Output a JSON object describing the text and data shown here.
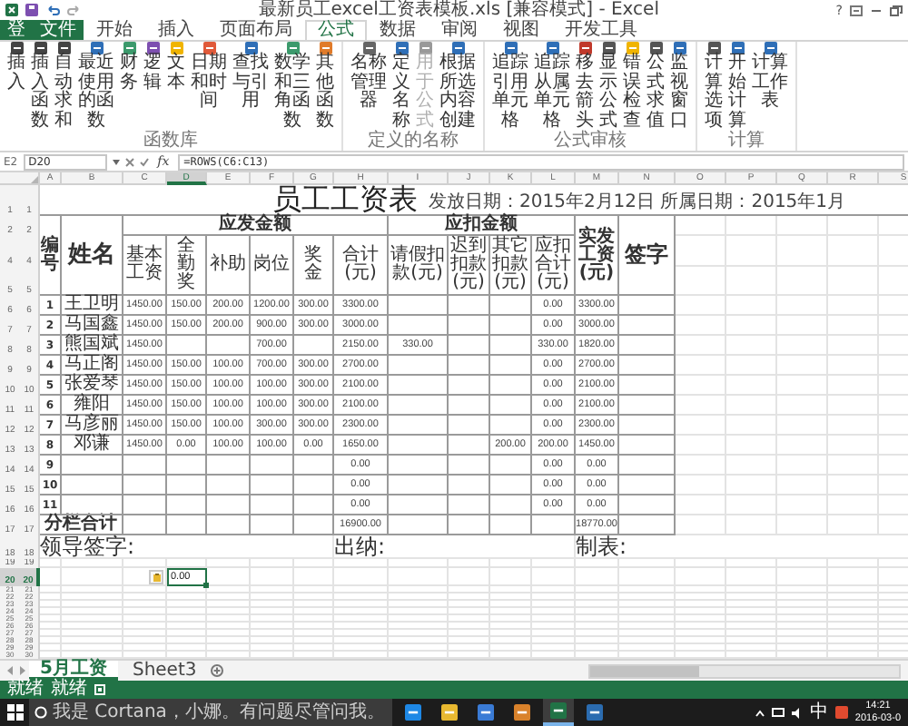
{
  "window": {
    "title": "最新员工excel工资表模板.xls [兼容模式] - Excel",
    "help": "?"
  },
  "ribbon_tabs": [
    {
      "label": "登",
      "kind": "account",
      "selected": false
    },
    {
      "label": "文件",
      "kind": "file",
      "selected": false
    },
    {
      "label": "开始",
      "kind": "tab",
      "selected": false
    },
    {
      "label": "插入",
      "kind": "tab",
      "selected": false
    },
    {
      "label": "页面布局",
      "kind": "tab",
      "selected": false
    },
    {
      "label": "公式",
      "kind": "tab",
      "selected": true
    },
    {
      "label": "数据",
      "kind": "tab",
      "selected": false
    },
    {
      "label": "审阅",
      "kind": "tab",
      "selected": false
    },
    {
      "label": "视图",
      "kind": "tab",
      "selected": false
    },
    {
      "label": "开发工具",
      "kind": "tab",
      "selected": false
    }
  ],
  "ribbon_groups": [
    {
      "label": "函数库",
      "items": [
        {
          "label": "插入",
          "color": "#444444",
          "disabled": false
        },
        {
          "label": "插入函数",
          "color": "#444444",
          "disabled": false
        },
        {
          "label": "自动求和",
          "color": "#444444",
          "disabled": false
        },
        {
          "label": "最近使用的函数",
          "color": "#2f6fb7",
          "disabled": false
        },
        {
          "label": "财务",
          "color": "#3c9a6c",
          "disabled": false
        },
        {
          "label": "逻辑",
          "color": "#7d4fb0",
          "disabled": false
        },
        {
          "label": "文本",
          "color": "#f0b400",
          "disabled": false
        },
        {
          "label": "日期和时间",
          "color": "#e05a3a",
          "disabled": false
        },
        {
          "label": "查找与引用",
          "color": "#2f6fb7",
          "disabled": false
        },
        {
          "label": "数学和三角函数",
          "color": "#3c9a6c",
          "disabled": false
        },
        {
          "label": "其他函数",
          "color": "#e07b2a",
          "disabled": false
        }
      ]
    },
    {
      "label": "定义的名称",
      "items": [
        {
          "label": "名称管理器",
          "color": "#666666",
          "disabled": false
        },
        {
          "label": "定义名称",
          "color": "#2f6fb7",
          "disabled": false
        },
        {
          "label": "用于公式",
          "color": "#999999",
          "disabled": true
        },
        {
          "label": "根据所选内容创建",
          "color": "#2f6fb7",
          "disabled": false
        }
      ]
    },
    {
      "label": "公式审核",
      "items": [
        {
          "label": "追踪引用单元格",
          "color": "#2f6fb7",
          "disabled": false
        },
        {
          "label": "追踪从属单元格",
          "color": "#2f6fb7",
          "disabled": false
        },
        {
          "label": "移去箭头",
          "color": "#c0392b",
          "disabled": false
        },
        {
          "label": "显示公式",
          "color": "#555555",
          "disabled": false
        },
        {
          "label": "错误检查",
          "color": "#f0b400",
          "disabled": false
        },
        {
          "label": "公式求值",
          "color": "#555555",
          "disabled": false
        },
        {
          "label": "监视窗口",
          "color": "#2f6fb7",
          "disabled": false
        }
      ]
    },
    {
      "label": "计算",
      "items": [
        {
          "label": "计算选项",
          "color": "#555555",
          "disabled": false
        },
        {
          "label": "开始计算",
          "color": "#2f6fb7",
          "disabled": false
        },
        {
          "label": "计算工作表",
          "color": "#2f6fb7",
          "disabled": false
        }
      ]
    }
  ],
  "formula_bar": {
    "cell_label": "E2",
    "name_box": "D20",
    "fx": "fx",
    "formula": "=ROWS(C6:C13)"
  },
  "columns": [
    {
      "letter": "A",
      "selected": false
    },
    {
      "letter": "B",
      "selected": false
    },
    {
      "letter": "C",
      "selected": false
    },
    {
      "letter": "D",
      "selected": true
    },
    {
      "letter": "E",
      "selected": false
    },
    {
      "letter": "F",
      "selected": false
    },
    {
      "letter": "G",
      "selected": false
    },
    {
      "letter": "H",
      "selected": false
    },
    {
      "letter": "I",
      "selected": false
    },
    {
      "letter": "J",
      "selected": false
    },
    {
      "letter": "K",
      "selected": false
    },
    {
      "letter": "L",
      "selected": false
    },
    {
      "letter": "M",
      "selected": false
    },
    {
      "letter": "N",
      "selected": false
    },
    {
      "letter": "O",
      "selected": false
    },
    {
      "letter": "P",
      "selected": false
    },
    {
      "letter": "Q",
      "selected": false
    },
    {
      "letter": "R",
      "selected": false
    },
    {
      "letter": "S",
      "selected": false
    }
  ],
  "row_headers": [
    {
      "labels": [
        "1",
        "1"
      ],
      "selected": false
    },
    {
      "labels": [
        "2",
        "2"
      ],
      "selected": false
    },
    {
      "labels": [
        "4",
        "4"
      ],
      "selected": false
    },
    {
      "labels": [
        "5",
        "5"
      ],
      "selected": false
    },
    {
      "labels": [
        "6",
        "6"
      ],
      "selected": false
    },
    {
      "labels": [
        "7",
        "7"
      ],
      "selected": false
    },
    {
      "labels": [
        "8",
        "8"
      ],
      "selected": false
    },
    {
      "labels": [
        "9",
        "9"
      ],
      "selected": false
    },
    {
      "labels": [
        "10",
        "10"
      ],
      "selected": false
    },
    {
      "labels": [
        "11",
        "11"
      ],
      "selected": false
    },
    {
      "labels": [
        "12",
        "12"
      ],
      "selected": false
    },
    {
      "labels": [
        "13",
        "13"
      ],
      "selected": false
    },
    {
      "labels": [
        "14",
        "14"
      ],
      "selected": false
    },
    {
      "labels": [
        "15",
        "15"
      ],
      "selected": false
    },
    {
      "labels": [
        "16",
        "16"
      ],
      "selected": false
    },
    {
      "labels": [
        "17",
        "17"
      ],
      "selected": false
    },
    {
      "labels": [
        "18",
        "18"
      ],
      "selected": false
    },
    {
      "labels": [
        "19",
        "19"
      ],
      "selected": false
    },
    {
      "labels": [
        "20",
        "20"
      ],
      "selected": true
    },
    {
      "labels": [
        "21",
        "21"
      ],
      "selected": false
    },
    {
      "labels": [
        "22",
        "22"
      ],
      "selected": false
    },
    {
      "labels": [
        "23",
        "23"
      ],
      "selected": false
    },
    {
      "labels": [
        "24",
        "24"
      ],
      "selected": false
    },
    {
      "labels": [
        "25",
        "25"
      ],
      "selected": false
    },
    {
      "labels": [
        "26",
        "26"
      ],
      "selected": false
    },
    {
      "labels": [
        "27",
        "27"
      ],
      "selected": false
    },
    {
      "labels": [
        "28",
        "28"
      ],
      "selected": false
    },
    {
      "labels": [
        "29",
        "29"
      ],
      "selected": false
    },
    {
      "labels": [
        "30",
        "30"
      ],
      "selected": false
    }
  ],
  "sheet": {
    "title": "员工工资表",
    "subtitle": "发放日期：2015年2月12日 所属日期：2015年1月",
    "header": {
      "number": "编号",
      "name": "姓名",
      "income_group": "应发金额",
      "deduction_group": "应扣金额",
      "net_pay": "实发工资(元)",
      "signature": "签字",
      "income_columns": [
        "基本工资",
        "全勤奖",
        "补助",
        "岗位",
        "奖金",
        "合计(元)"
      ],
      "deduction_columns": [
        "请假扣款(元)",
        "迟到扣款(元)",
        "其它扣款(元)",
        "应扣合计(元)"
      ]
    },
    "rows": [
      {
        "number": "1",
        "name": "王卫明",
        "values": {
          "C": "1450.00",
          "D": "150.00",
          "E": "200.00",
          "F": "1200.00",
          "G": "300.00",
          "H": "3300.00",
          "L": "0.00",
          "M": "3300.00"
        }
      },
      {
        "number": "2",
        "name": "马国鑫",
        "values": {
          "C": "1450.00",
          "D": "150.00",
          "E": "200.00",
          "F": "900.00",
          "G": "300.00",
          "H": "3000.00",
          "L": "0.00",
          "M": "3000.00"
        }
      },
      {
        "number": "3",
        "name": "熊国斌",
        "values": {
          "C": "1450.00",
          "F": "700.00",
          "H": "2150.00",
          "I": "330.00",
          "L": "330.00",
          "M": "1820.00"
        }
      },
      {
        "number": "4",
        "name": "马正阁",
        "values": {
          "C": "1450.00",
          "D": "150.00",
          "E": "100.00",
          "F": "700.00",
          "G": "300.00",
          "H": "2700.00",
          "L": "0.00",
          "M": "2700.00"
        }
      },
      {
        "number": "5",
        "name": "张爱琴",
        "values": {
          "C": "1450.00",
          "D": "150.00",
          "E": "100.00",
          "F": "100.00",
          "G": "300.00",
          "H": "2100.00",
          "L": "0.00",
          "M": "2100.00"
        }
      },
      {
        "number": "6",
        "name": "雍阳",
        "values": {
          "C": "1450.00",
          "D": "150.00",
          "E": "100.00",
          "F": "100.00",
          "G": "300.00",
          "H": "2100.00",
          "L": "0.00",
          "M": "2100.00"
        }
      },
      {
        "number": "7",
        "name": "马彦丽",
        "values": {
          "C": "1450.00",
          "D": "150.00",
          "E": "100.00",
          "F": "300.00",
          "G": "300.00",
          "H": "2300.00",
          "L": "0.00",
          "M": "2300.00"
        }
      },
      {
        "number": "8",
        "name": "邓谦",
        "values": {
          "C": "1450.00",
          "D": "0.00",
          "E": "100.00",
          "F": "100.00",
          "G": "0.00",
          "H": "1650.00",
          "K": "200.00",
          "L": "200.00",
          "M": "1450.00"
        }
      },
      {
        "number": "9",
        "values": {
          "H": "0.00",
          "L": "0.00",
          "M": "0.00"
        }
      },
      {
        "number": "10",
        "values": {
          "H": "0.00",
          "L": "0.00",
          "M": "0.00"
        }
      },
      {
        "number": "11",
        "values": {
          "H": "0.00",
          "L": "0.00",
          "M": "0.00"
        }
      }
    ],
    "total": {
      "label": "分栏合计",
      "values": {
        "H": "16900.00",
        "M": "18770.00"
      }
    },
    "signatures": [
      "领导签字:",
      "出纳:",
      "制表:"
    ],
    "active_cell": {
      "value": "0.00"
    }
  },
  "sheet_tabs": [
    {
      "label": "5月工资",
      "selected": true
    },
    {
      "label": "Sheet3",
      "selected": false
    }
  ],
  "status_bar": [
    "就绪",
    "就绪"
  ],
  "taskbar": {
    "search": {
      "placeholder": "我是 Cortana，小娜。有问题尽管问我。"
    },
    "apps": [
      {
        "color": "#1e88e5",
        "selected": false
      },
      {
        "color": "#e8b830",
        "selected": false
      },
      {
        "color": "#3a7bd5",
        "selected": false
      },
      {
        "color": "#d9822b",
        "selected": false
      },
      {
        "color": "#217346",
        "selected": true
      },
      {
        "color": "#2b6cb0",
        "selected": false
      }
    ],
    "input_method": "中",
    "time": "14:21",
    "date": "2016-03-0"
  }
}
